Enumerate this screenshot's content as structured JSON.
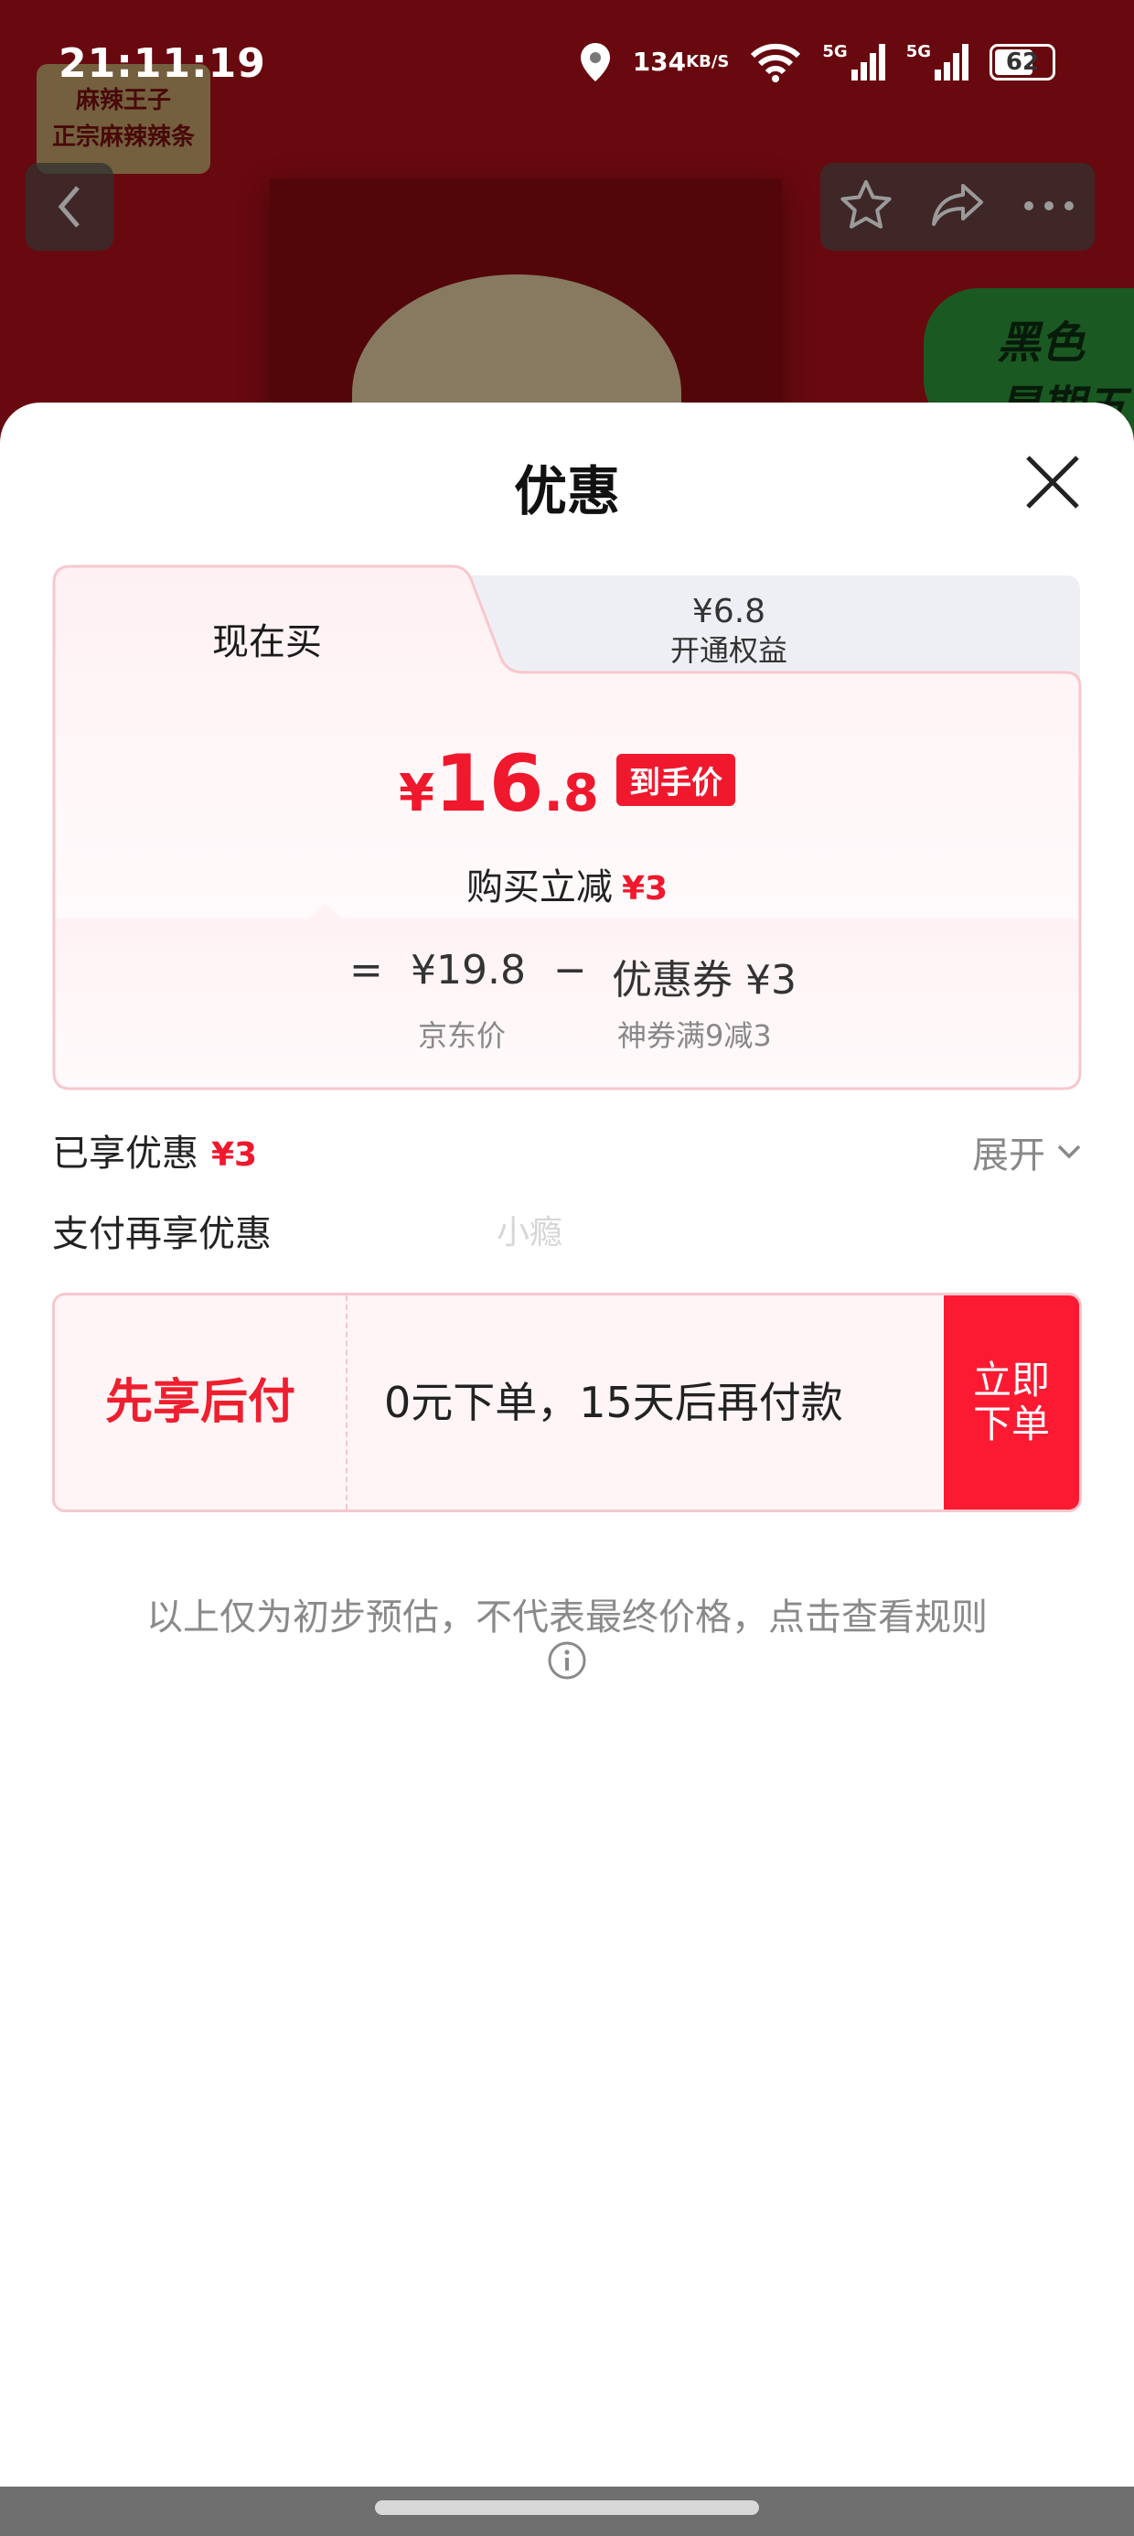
{
  "status_bar": {
    "time": "21:11:19",
    "net_speed_value": "134",
    "net_speed_unit": "KB/S",
    "sim1": "5G",
    "sim2": "5G",
    "battery": "62"
  },
  "background": {
    "brand_logo": "麻辣王子\n正宗麻辣辣条",
    "promo_badge": "黑色\n星期五"
  },
  "sheet": {
    "title": "优惠",
    "tabs": [
      {
        "label": "现在买"
      },
      {
        "price": "¥6.8",
        "label": "开通权益"
      }
    ],
    "final_price": {
      "yen": "¥",
      "int": "16",
      "dec": ".8",
      "badge": "到手价"
    },
    "reduce": {
      "label": "购买立减",
      "amount": "¥3"
    },
    "calc": {
      "equals": "=",
      "jd_price": "¥19.8",
      "minus": "−",
      "coupon": "优惠券 ¥3",
      "jd_price_label": "京东价",
      "coupon_label": "神券满9减3"
    },
    "saved": {
      "label": "已享优惠",
      "amount": "¥3"
    },
    "expand_label": "展开",
    "pay_more_label": "支付再享优惠",
    "watermark": "小瘾",
    "bnpl": {
      "title": "先享后付",
      "desc": "0元下单，15天后再付款",
      "button_line1": "立即",
      "button_line2": "下单"
    },
    "disclaimer": "以上仅为初步预估，不代表最终价格，点击查看规则"
  },
  "colors": {
    "accent_red": "#f0182d",
    "button_red": "#fc1a32",
    "card_border": "#f7c8ce"
  }
}
